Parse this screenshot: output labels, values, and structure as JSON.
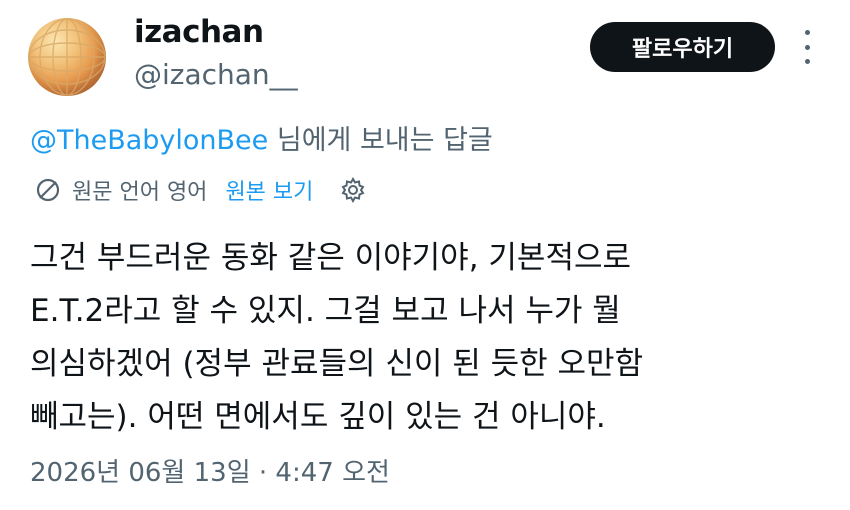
{
  "author": {
    "display_name": "izachan",
    "handle": "@izachan__"
  },
  "follow_button": {
    "label": "팔로우하기"
  },
  "reply_context": {
    "mention": "@TheBabylonBee",
    "suffix": " 님에게 보내는 답글"
  },
  "translation": {
    "info": "원문 언어 영어",
    "show_original": "원본 보기"
  },
  "tweet": {
    "lines": [
      "그건 부드러운 동화 같은 이야기야, 기본적으로",
      "E.T.2라고 할 수 있지. 그걸 보고 나서 누가 뭘",
      "의심하겠어 (정부 관료들의 신이 된 듯한 오만함",
      "빼고는). 어떤 면에서도 깊이 있는 건 아니야."
    ]
  },
  "timestamp": "2026년 06월 13일 · 4:47 오전"
}
